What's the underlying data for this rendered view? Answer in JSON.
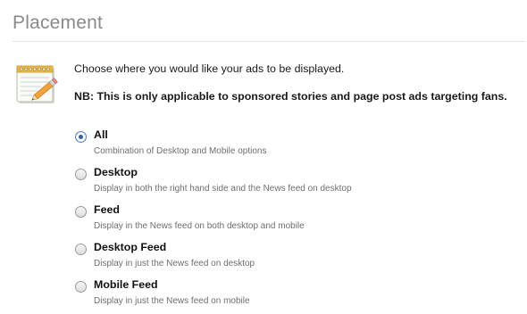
{
  "section": {
    "title": "Placement"
  },
  "intro": {
    "text": "Choose where you would like your ads to be displayed.",
    "note": "NB: This is only applicable to sponsored stories and page post ads targeting fans."
  },
  "placement_options": [
    {
      "label": "All",
      "description": "Combination of Desktop and Mobile options",
      "selected": true
    },
    {
      "label": "Desktop",
      "description": "Display in both the right hand side and the News feed on desktop",
      "selected": false
    },
    {
      "label": "Feed",
      "description": "Display in the News feed on both desktop and mobile",
      "selected": false
    },
    {
      "label": "Desktop Feed",
      "description": "Display in just the News feed on desktop",
      "selected": false
    },
    {
      "label": "Mobile Feed",
      "description": "Display in just the News feed on mobile",
      "selected": false
    }
  ],
  "colors": {
    "title": "#8a8a8a",
    "radio_selected": "#2f5fa8",
    "description": "#6f6f6f"
  },
  "icons": {
    "note": "notepad-pencil-icon"
  }
}
